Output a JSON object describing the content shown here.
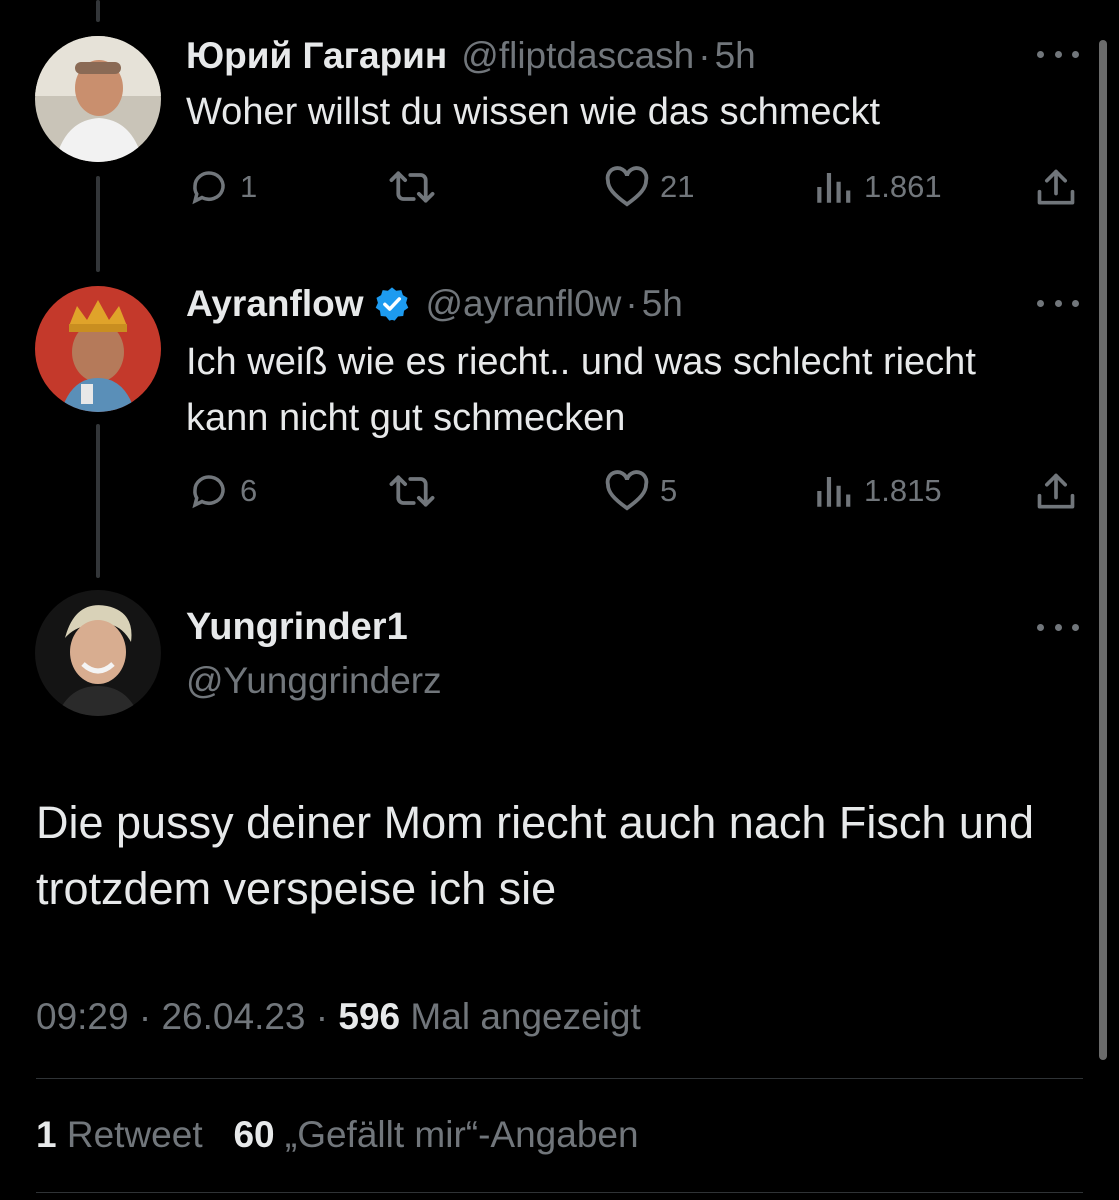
{
  "tweets": [
    {
      "name": "Юрий Гагарин",
      "handle": "@fliptdascash",
      "separator": "·",
      "time": "5h",
      "text": "Woher willst du wissen wie das schmeckt",
      "replies": "1",
      "retweets": "",
      "likes": "21",
      "views": "1.861"
    },
    {
      "name": "Ayranflow",
      "verified": true,
      "handle": "@ayranfl0w",
      "separator": "·",
      "time": "5h",
      "text": "Ich weiß wie es riecht.. und was schlecht riecht kann nicht gut schmecken",
      "replies": "6",
      "retweets": "",
      "likes": "5",
      "views": "1.815"
    }
  ],
  "main_tweet": {
    "name": "Yungrinder1",
    "handle": "@Yunggrinderz",
    "text": "Die pussy deiner Mom riecht auch nach Fisch und trotzdem verspeise ich sie",
    "time": "09:29",
    "sep1": "·",
    "date": "26.04.23",
    "sep2": "·",
    "views_count": "596",
    "views_label": "Mal angezeigt",
    "retweet_count": "1",
    "retweet_label": "Retweet",
    "like_count": "60",
    "like_label": "„Gefällt mir“-Angaben"
  },
  "colors": {
    "background": "#000000",
    "text": "#e7e9ea",
    "muted": "#71767b",
    "verified": "#1d9bf0",
    "divider": "#2f3336"
  },
  "icons": [
    "reply-icon",
    "retweet-icon",
    "like-icon",
    "views-icon",
    "share-icon",
    "more-icon",
    "verified-badge-icon"
  ]
}
